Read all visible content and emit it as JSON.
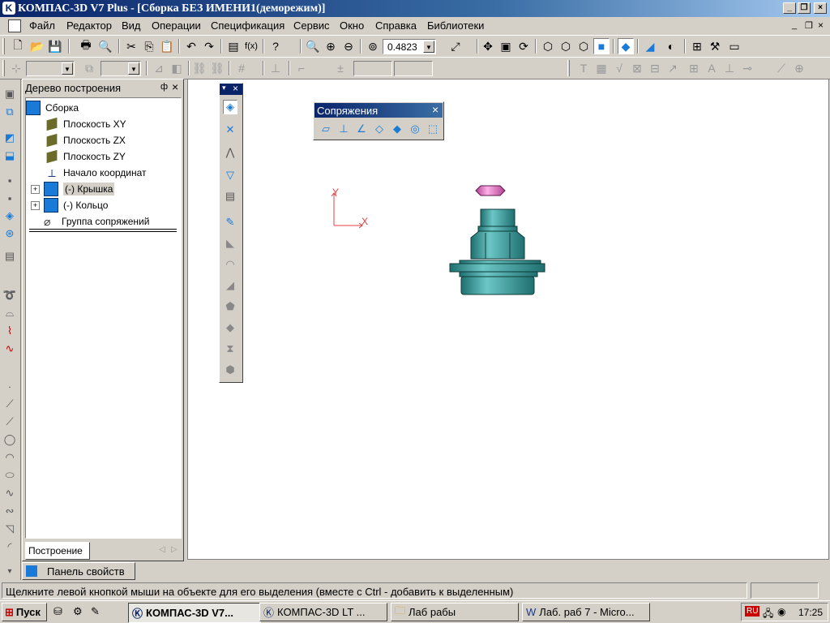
{
  "window": {
    "title": "КОМПАС-3D V7 Plus - [Сборка БЕЗ ИМЕНИ1(деморежим)]"
  },
  "menu": [
    "Файл",
    "Редактор",
    "Вид",
    "Операции",
    "Спецификация",
    "Сервис",
    "Окно",
    "Справка",
    "Библиотеки"
  ],
  "toolbar": {
    "zoom_value": "0.4823"
  },
  "tree": {
    "title": "Дерево построения",
    "pin": "ф",
    "close": "×",
    "items": [
      {
        "label": "Сборка",
        "icon": "assembly-icon"
      },
      {
        "label": "Плоскость XY",
        "icon": "plane-icon"
      },
      {
        "label": "Плоскость ZX",
        "icon": "plane-icon"
      },
      {
        "label": "Плоскость ZY",
        "icon": "plane-icon"
      },
      {
        "label": "Начало координат",
        "icon": "origin-icon"
      },
      {
        "label": "(-) Крышка",
        "icon": "part-icon"
      },
      {
        "label": "(-) Кольцо",
        "icon": "part-icon"
      },
      {
        "label": "Группа сопряжений",
        "icon": "mates-icon"
      }
    ],
    "tab_label": "Построение"
  },
  "mates_panel": {
    "title": "Сопряжения"
  },
  "canvas": {
    "axis_y": "Y",
    "axis_x": "X"
  },
  "property_panel": {
    "label": "Панель свойств"
  },
  "status": {
    "text": "Щелкните левой кнопкой мыши на объекте для его выделения (вместе с Ctrl - добавить к выделенным)"
  },
  "taskbar": {
    "start": "Пуск",
    "tasks": [
      "КОМПАС-3D V7...",
      "КОМПАС-3D LT ...",
      "Лаб рабы",
      "Лаб. раб  7 - Micro..."
    ],
    "lang": "RU",
    "clock": "17:25"
  },
  "colors": {
    "titlebar": "#0a246a",
    "model": "#3a9a9a",
    "ring": "#e070c0"
  }
}
